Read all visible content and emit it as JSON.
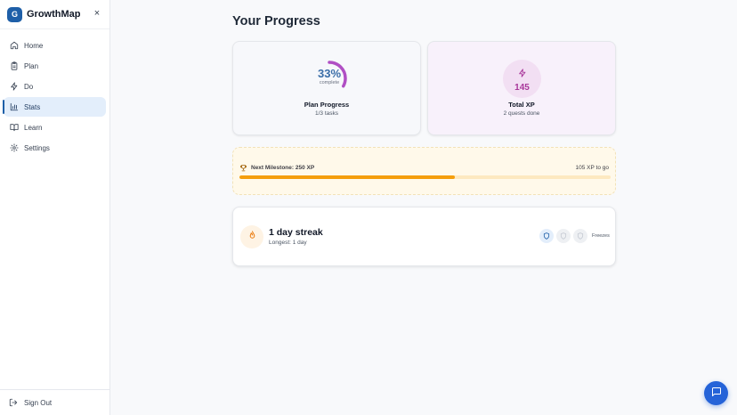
{
  "app": {
    "logo_letter": "G",
    "name": "GrowthMap",
    "close_symbol": "×"
  },
  "sidebar": {
    "items": [
      {
        "label": "Home",
        "icon": "home-icon",
        "active": false
      },
      {
        "label": "Plan",
        "icon": "clipboard-icon",
        "active": false
      },
      {
        "label": "Do",
        "icon": "lightning-icon",
        "active": false
      },
      {
        "label": "Stats",
        "icon": "bar-chart-icon",
        "active": true
      },
      {
        "label": "Learn",
        "icon": "book-icon",
        "active": false
      },
      {
        "label": "Settings",
        "icon": "gear-icon",
        "active": false
      }
    ],
    "signout_label": "Sign Out"
  },
  "main": {
    "title": "Your Progress",
    "plan_card": {
      "percent_label": "33%",
      "percent": 33,
      "sub": "complete",
      "title": "Plan Progress",
      "detail": "1/3 tasks"
    },
    "xp_card": {
      "value": "145",
      "title": "Total XP",
      "detail": "2 quests done"
    },
    "milestone": {
      "label": "Next Milestone: 250 XP",
      "remaining": "105 XP to go",
      "progress": 0.58
    },
    "streak": {
      "title": "1 day streak",
      "longest": "Longest: 1 day",
      "freezes_label": "Freezes",
      "freezes_active": 1,
      "freezes_total": 3
    }
  },
  "colors": {
    "accent": "#1e5fa8",
    "xp": "#a8369a",
    "milestone": "#f59e0b",
    "chat": "#2563d8"
  }
}
